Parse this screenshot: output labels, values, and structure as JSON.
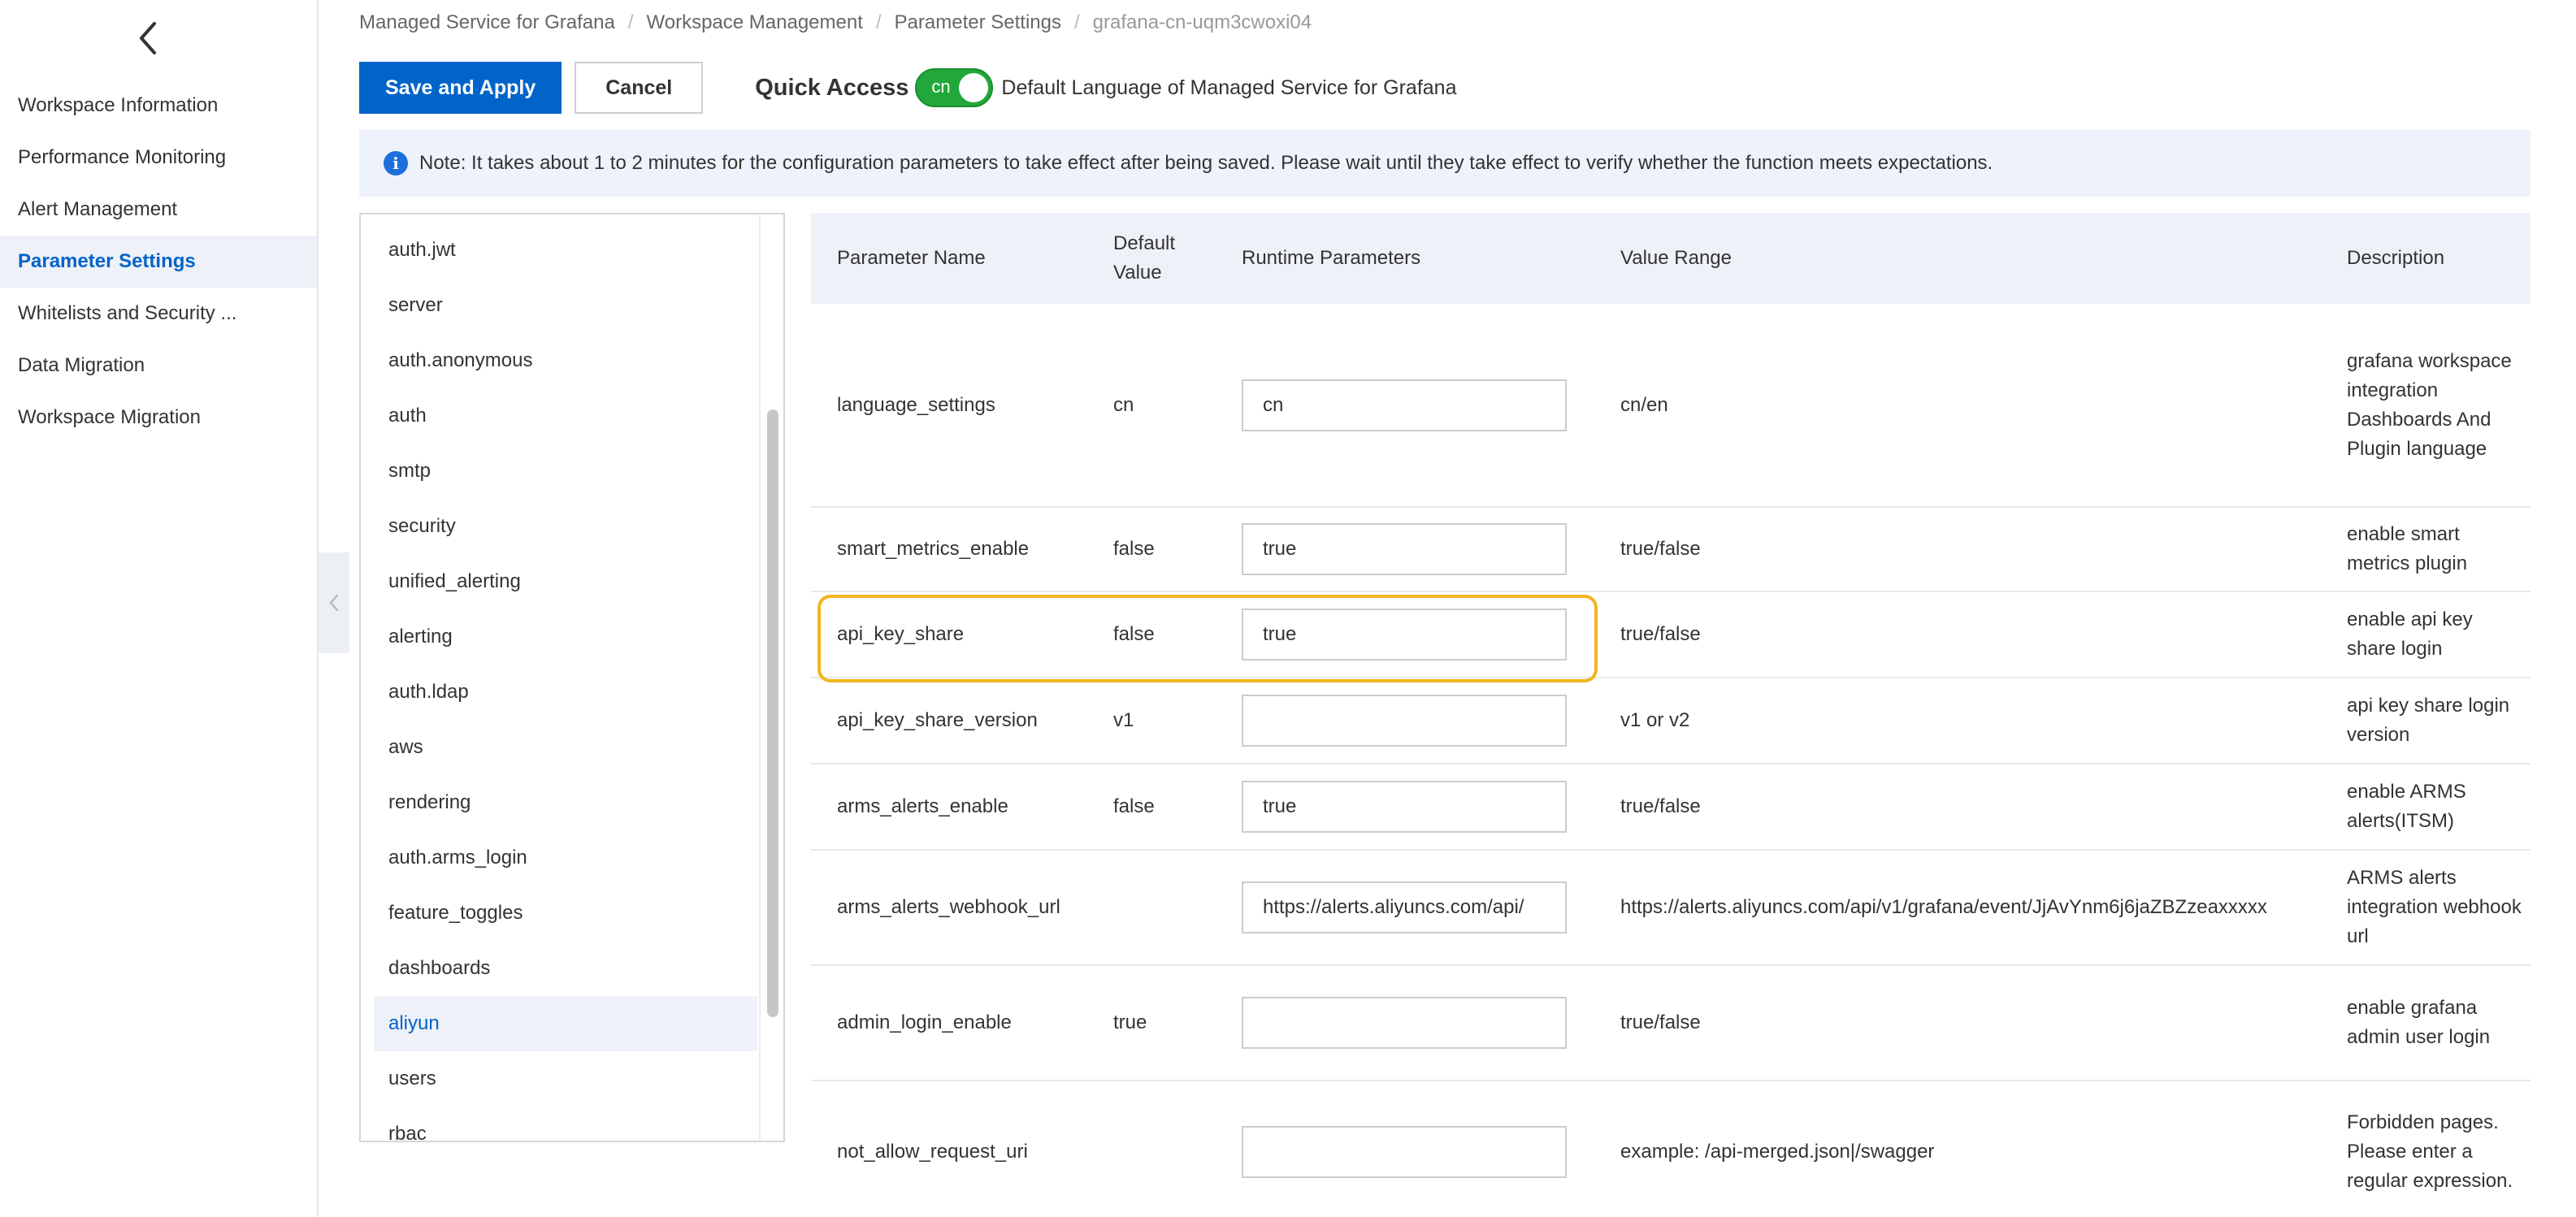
{
  "sidebar": {
    "items": [
      {
        "label": "Workspace Information",
        "active": false
      },
      {
        "label": "Performance Monitoring",
        "active": false
      },
      {
        "label": "Alert Management",
        "active": false
      },
      {
        "label": "Parameter Settings",
        "active": true
      },
      {
        "label": "Whitelists and Security ...",
        "active": false
      },
      {
        "label": "Data Migration",
        "active": false
      },
      {
        "label": "Workspace Migration",
        "active": false
      }
    ]
  },
  "breadcrumb": [
    "Managed Service for Grafana",
    "Workspace Management",
    "Parameter Settings",
    "grafana-cn-uqm3cwoxi04"
  ],
  "toolbar": {
    "save_label": "Save and Apply",
    "cancel_label": "Cancel",
    "quick_access_label": "Quick Access",
    "toggle_value": "cn",
    "toggle_on": true,
    "toggle_description": "Default Language of Managed Service for Grafana"
  },
  "notice": {
    "text": "Note: It takes about 1 to 2 minutes for the configuration parameters to take effect after being saved. Please wait until they take effect to verify whether the function meets expectations."
  },
  "sections": {
    "items": [
      "auth.jwt",
      "server",
      "auth.anonymous",
      "auth",
      "smtp",
      "security",
      "unified_alerting",
      "alerting",
      "auth.ldap",
      "aws",
      "rendering",
      "auth.arms_login",
      "feature_toggles",
      "dashboards",
      "aliyun",
      "users",
      "rbac"
    ],
    "selected": "aliyun"
  },
  "params": {
    "headers": {
      "name": "Parameter Name",
      "default": "Default Value",
      "runtime": "Runtime Parameters",
      "range": "Value Range",
      "description": "Description"
    },
    "rows": [
      {
        "name": "language_settings",
        "default": "cn",
        "runtime": "cn",
        "range": "cn/en",
        "description": "grafana workspace integration Dashboards And Plugin language"
      },
      {
        "name": "smart_metrics_enable",
        "default": "false",
        "runtime": "true",
        "range": "true/false",
        "description": "enable smart metrics plugin"
      },
      {
        "name": "api_key_share",
        "default": "false",
        "runtime": "true",
        "range": "true/false",
        "description": "enable api key share login"
      },
      {
        "name": "api_key_share_version",
        "default": "v1",
        "runtime": "",
        "range": "v1 or v2",
        "description": "api key share login version"
      },
      {
        "name": "arms_alerts_enable",
        "default": "false",
        "runtime": "true",
        "range": "true/false",
        "description": "enable ARMS alerts(ITSM)"
      },
      {
        "name": "arms_alerts_webhook_url",
        "default": "",
        "runtime": "https://alerts.aliyuncs.com/api/",
        "range": "https://alerts.aliyuncs.com/api/v1/grafana/event/JjAvYnm6j6jaZBZzeaxxxxx",
        "description": "ARMS alerts integration webhook url"
      },
      {
        "name": "admin_login_enable",
        "default": "true",
        "runtime": "",
        "range": "true/false",
        "description": "enable grafana admin user login"
      },
      {
        "name": "not_allow_request_uri",
        "default": "",
        "runtime": "",
        "range": "example: /api-merged.json|/swagger",
        "description": "Forbidden pages. Please enter a regular expression."
      }
    ]
  },
  "colors": {
    "primary": "#0064c8",
    "toggle_on": "#22a83a",
    "highlight_border": "#f2b51d",
    "active_bg": "#eef1f8"
  },
  "icons": {
    "back": "chevron-left-icon",
    "collapse": "chevron-left-icon",
    "info": "info-icon"
  }
}
